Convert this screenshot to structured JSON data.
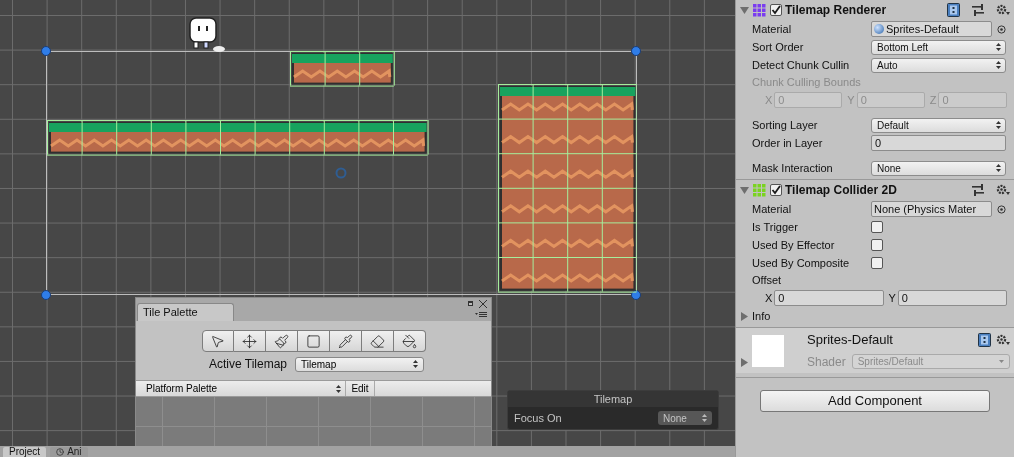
{
  "scene": {
    "overlay": {
      "title": "Tilemap",
      "label": "Focus On",
      "value": "None"
    }
  },
  "tile_palette": {
    "tab": "Tile Palette",
    "active_tilemap_label": "Active Tilemap",
    "active_tilemap": "Tilemap",
    "palette": "Platform Palette",
    "edit": "Edit"
  },
  "bottom_tabs": [
    {
      "label": "Project",
      "selected": true,
      "kind": "plain"
    },
    {
      "label": "Ani",
      "selected": false,
      "kind": "clock"
    }
  ],
  "inspector": {
    "components": [
      {
        "title": "Tilemap Renderer",
        "enabled": true,
        "expanded": true,
        "help": true,
        "kind": "renderer",
        "rows": [
          {
            "kind": "object",
            "label": "Material",
            "value": "Sprites-Default",
            "sphere": true
          },
          {
            "kind": "dropdown",
            "label": "Sort Order",
            "value": "Bottom Left"
          },
          {
            "kind": "dropdown",
            "label": "Detect Chunk Cullin",
            "value": "Auto"
          },
          {
            "kind": "label",
            "label": "Chunk Culling Bounds",
            "disabled": true
          },
          {
            "kind": "vector",
            "disabled": true,
            "fields": [
              {
                "axis": "X",
                "value": "0"
              },
              {
                "axis": "Y",
                "value": "0"
              },
              {
                "axis": "Z",
                "value": "0"
              }
            ]
          },
          {
            "kind": "dropdown",
            "label": "Sorting Layer",
            "value": "Default",
            "gap_before": true
          },
          {
            "kind": "text",
            "label": "Order in Layer",
            "value": "0"
          },
          {
            "kind": "dropdown",
            "label": "Mask Interaction",
            "value": "None",
            "gap_before": true
          }
        ]
      },
      {
        "title": "Tilemap Collider 2D",
        "enabled": true,
        "expanded": true,
        "help": false,
        "kind": "collider",
        "rows": [
          {
            "kind": "object",
            "label": "Material",
            "value": "None (Physics Mater",
            "sphere": false
          },
          {
            "kind": "checkbox",
            "label": "Is Trigger",
            "checked": false
          },
          {
            "kind": "checkbox",
            "label": "Used By Effector",
            "checked": false
          },
          {
            "kind": "checkbox",
            "label": "Used By Composite",
            "checked": false
          },
          {
            "kind": "label",
            "label": "Offset",
            "disabled": false
          },
          {
            "kind": "vector",
            "disabled": false,
            "fields": [
              {
                "axis": "X",
                "value": "0"
              },
              {
                "axis": "Y",
                "value": "0"
              }
            ]
          },
          {
            "kind": "foldout",
            "label": "Info",
            "expanded": false
          }
        ]
      }
    ],
    "material": {
      "name": "Sprites-Default",
      "shader_label": "Shader",
      "shader": "Sprites/Default",
      "expanded": false
    },
    "add_button": "Add Component"
  }
}
